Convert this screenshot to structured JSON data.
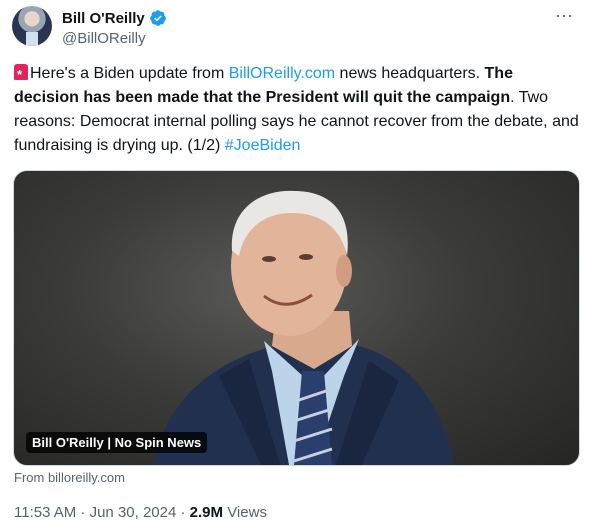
{
  "author": {
    "display_name": "Bill O'Reilly",
    "handle": "@BillOReilly",
    "verified_icon": "verified-badge-icon",
    "verified_color": "#1d9bf0"
  },
  "more_icon": "⋯",
  "tweet": {
    "text_1": "Here's a Biden update from ",
    "link_1": "BillOReilly.com",
    "text_2": " news headquarters.  ",
    "bold": "The decision has been made that the President will quit the campaign",
    "text_3": ". Two reasons: Democrat internal polling says he cannot recover from the debate, and fundraising is drying up. (1/2)  ",
    "hashtag": "#JoeBiden"
  },
  "media": {
    "label": "Bill O'Reilly | No Spin News"
  },
  "source": "From billoreilly.com",
  "meta": {
    "timestamp": "11:53 AM · Jun 30, 2024 · ",
    "views_count": "2.9M",
    "views_label": " Views"
  },
  "colors": {
    "link": "#1d9bf0",
    "secondary_text": "#536471",
    "siren": "#e0245e"
  }
}
